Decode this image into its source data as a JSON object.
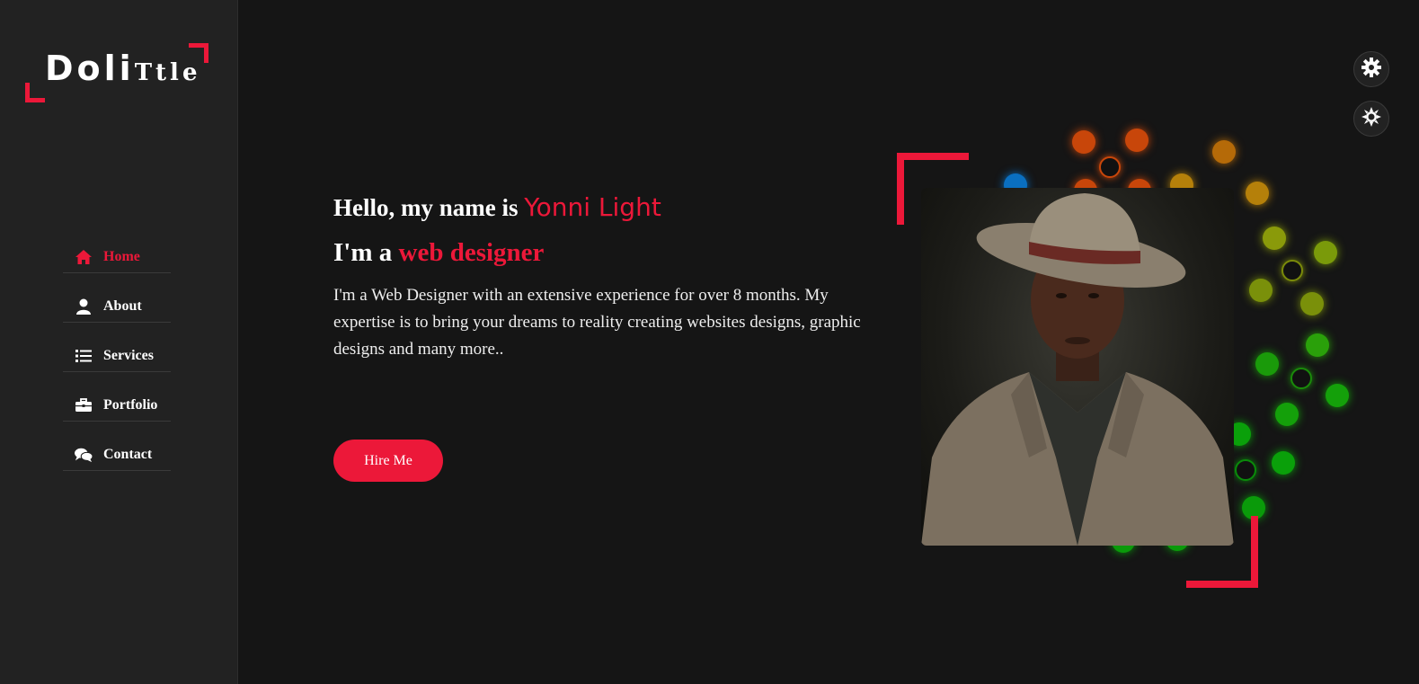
{
  "logo": {
    "part1": "Doli",
    "part2": "Ttle"
  },
  "nav": {
    "items": [
      {
        "label": "Home",
        "icon": "home-icon",
        "active": true
      },
      {
        "label": "About",
        "icon": "user-icon",
        "active": false
      },
      {
        "label": "Services",
        "icon": "list-icon",
        "active": false
      },
      {
        "label": "Portfolio",
        "icon": "briefcase-icon",
        "active": false
      },
      {
        "label": "Contact",
        "icon": "comments-icon",
        "active": false
      }
    ]
  },
  "hero": {
    "greeting_prefix": "Hello, my name is ",
    "name": "Yonni Light",
    "role_prefix": "I'm a ",
    "role": "web designer",
    "description": "I'm a Web Designer with an extensive experience for over 8 months. My expertise is to bring your dreams to reality creating websites designs, graphic designs and many more..",
    "cta_label": "Hire Me"
  },
  "colors": {
    "accent": "#ec1839",
    "background": "#151515",
    "sidebar": "#222222"
  },
  "controls": {
    "settings_icon": "gear-icon",
    "theme_icon": "sun-icon"
  }
}
